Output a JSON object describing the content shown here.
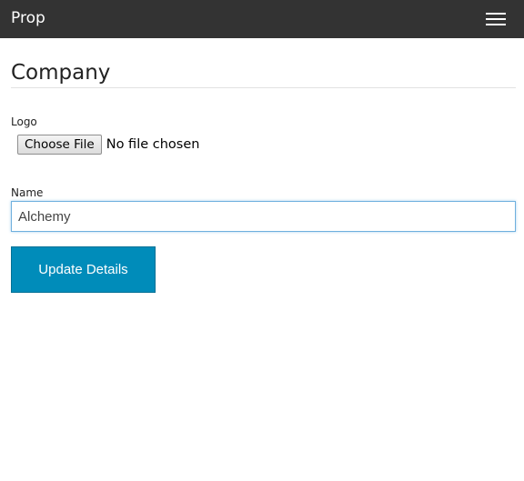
{
  "app": {
    "brand": "Prop",
    "menu_icon": "hamburger-menu-icon"
  },
  "page": {
    "title": "Company"
  },
  "form": {
    "logo_label": "Logo",
    "choose_file_label": "Choose File",
    "file_status": "No file chosen",
    "name_label": "Name",
    "name_value": "Alchemy",
    "submit_label": "Update Details"
  },
  "colors": {
    "topbar": "#333333",
    "primary_button": "#008cba",
    "input_focus_border": "#6fb0de"
  }
}
